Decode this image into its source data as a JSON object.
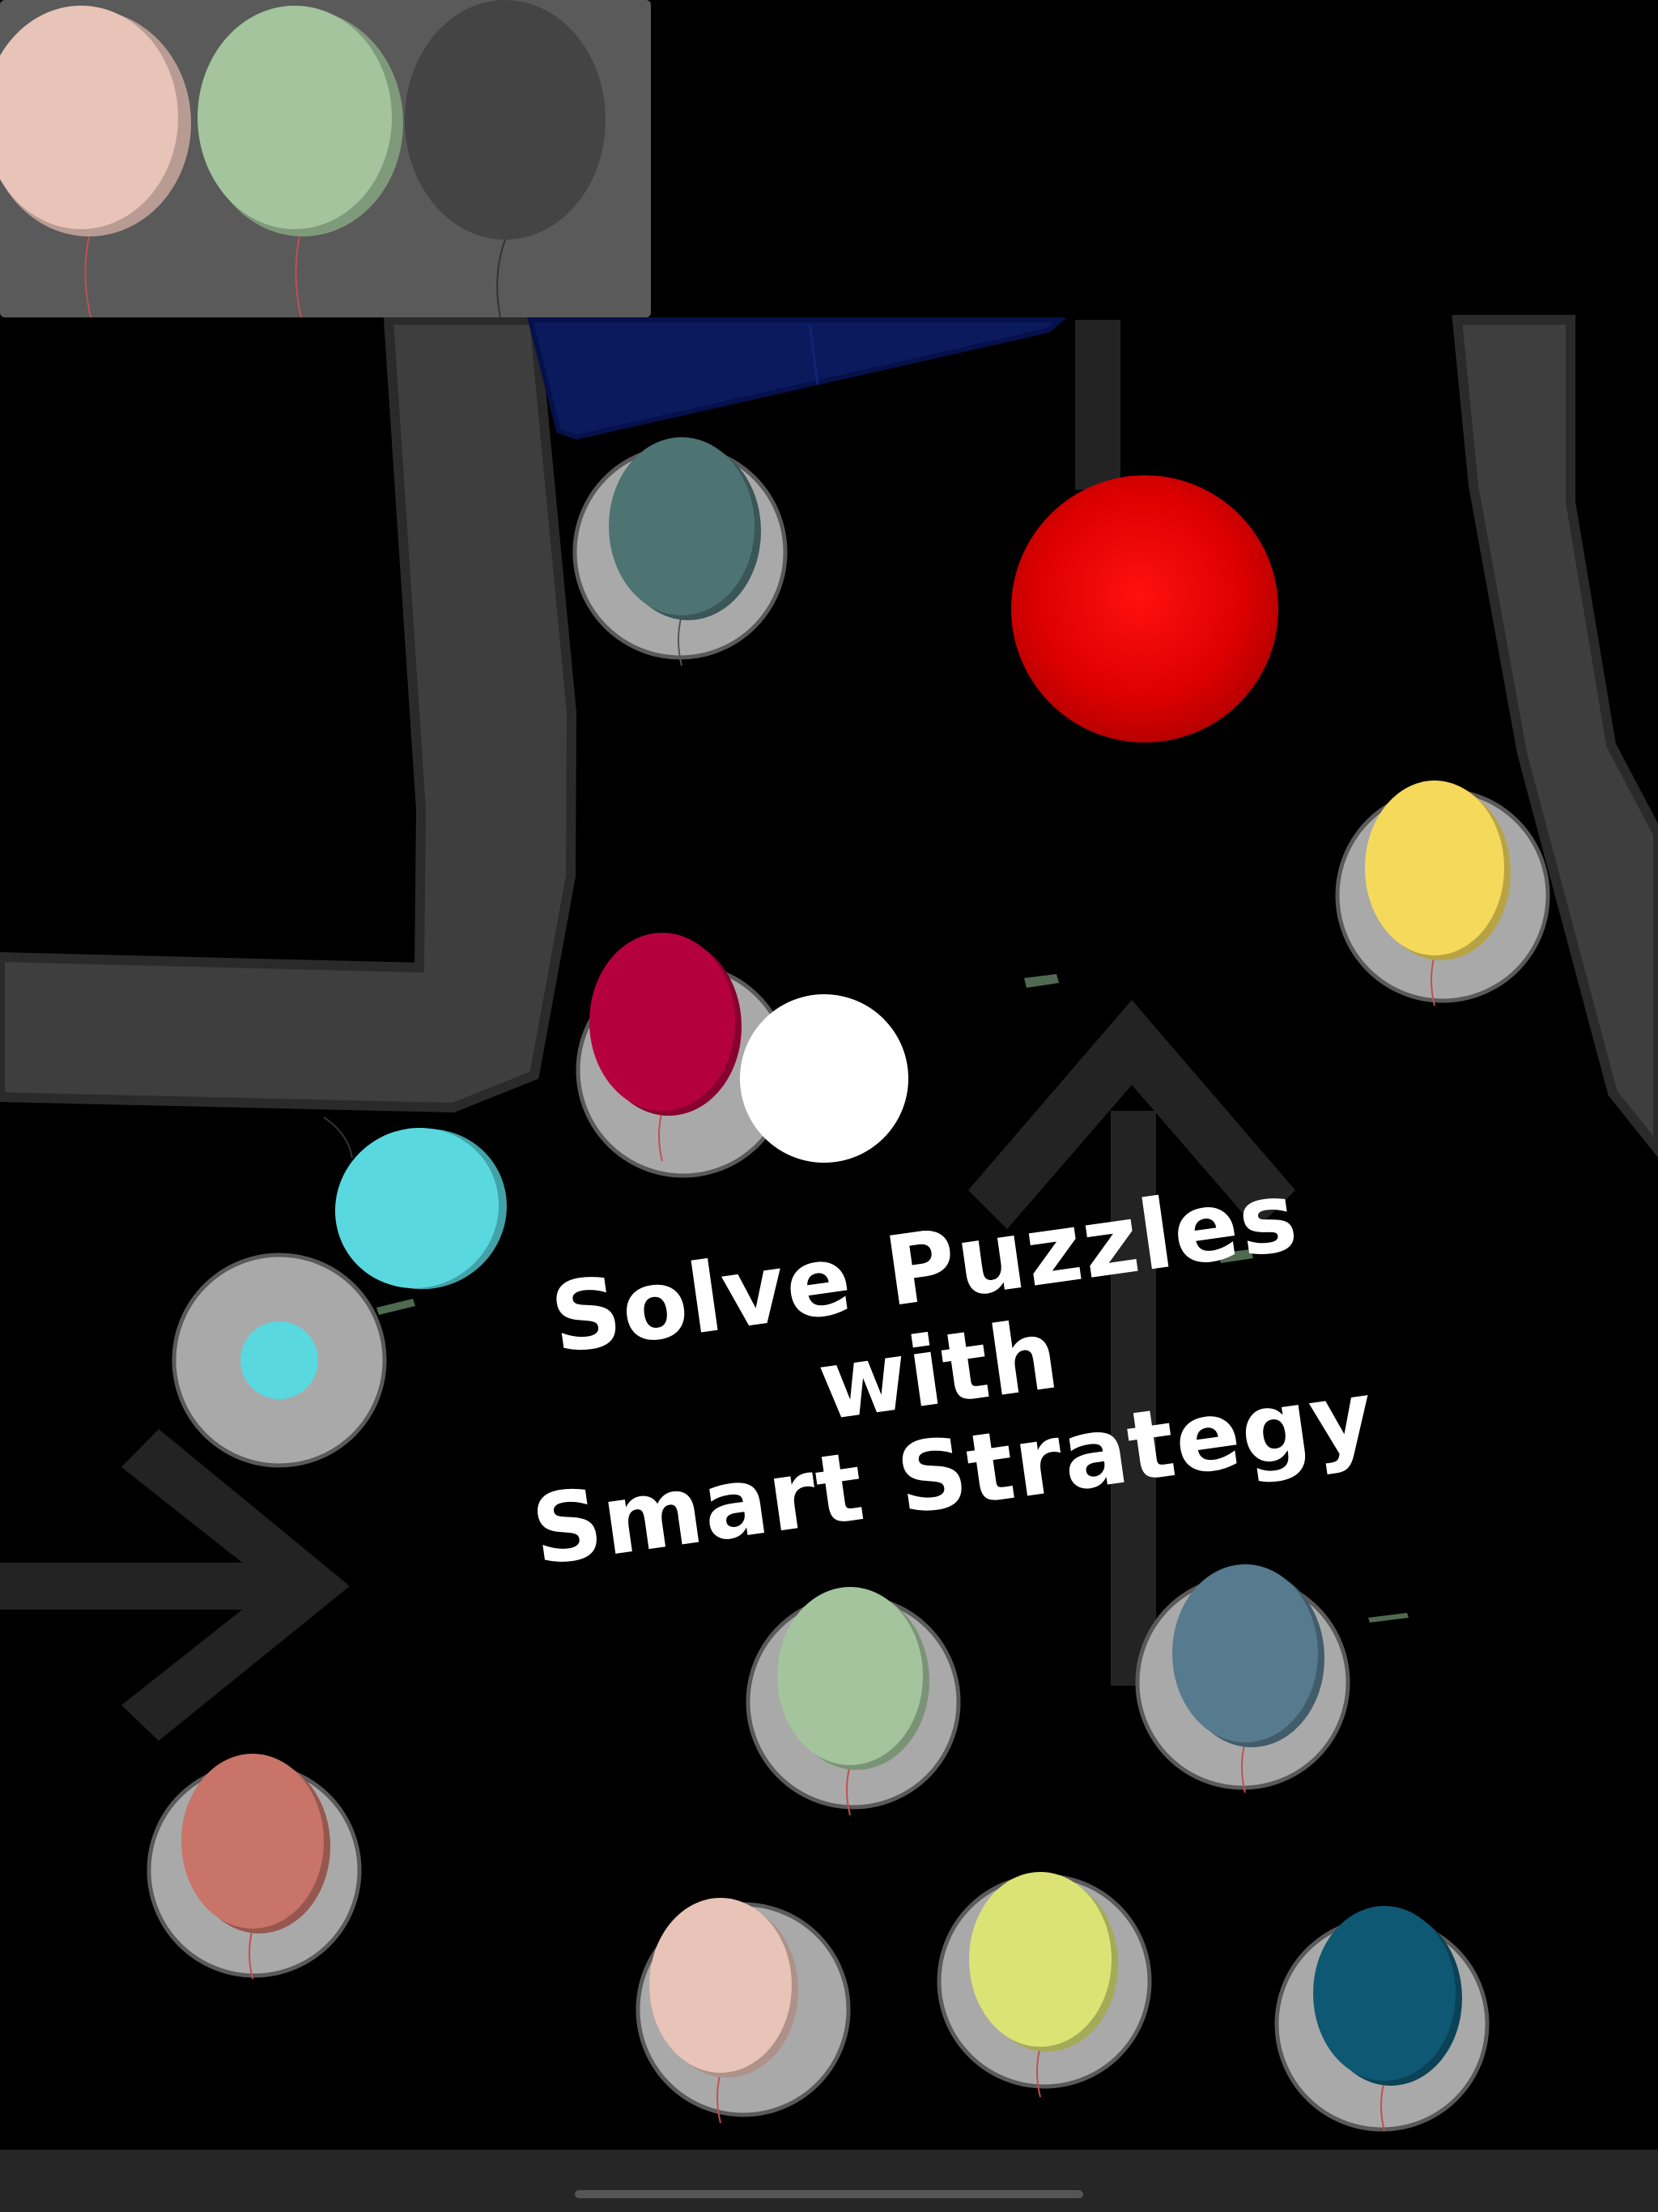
{
  "promo": {
    "line1": "Solve Puzzles",
    "line2": "with",
    "line3": "Smart Strategy"
  },
  "tray": {
    "slots": [
      {
        "color": "#e8c3b7",
        "filled": true
      },
      {
        "color": "#a3c49d",
        "filled": true
      },
      {
        "color": "#444444",
        "filled": false
      }
    ]
  },
  "colors": {
    "background": "#000000",
    "track": "#3e3e3e",
    "track_edge": "#2a2a2a",
    "pad": "#a9a9a9",
    "arrow": "#232323",
    "ball": "#ff0000",
    "white_ball": "#ffffff",
    "blue_block": "#0a1a5c"
  },
  "balloons": [
    {
      "name": "balloon-teal-gray",
      "color": "#4d7372"
    },
    {
      "name": "balloon-yellow",
      "color": "#f5d95a"
    },
    {
      "name": "balloon-crimson",
      "color": "#b5003e"
    },
    {
      "name": "balloon-cyan",
      "color": "#59d8e0"
    },
    {
      "name": "balloon-sage",
      "color": "#a3c49d"
    },
    {
      "name": "balloon-steel-blue",
      "color": "#567a8e"
    },
    {
      "name": "balloon-salmon",
      "color": "#c87468"
    },
    {
      "name": "balloon-peach",
      "color": "#e8c3b7"
    },
    {
      "name": "balloon-lime",
      "color": "#dbe374"
    },
    {
      "name": "balloon-navy-teal",
      "color": "#0f5873"
    }
  ]
}
